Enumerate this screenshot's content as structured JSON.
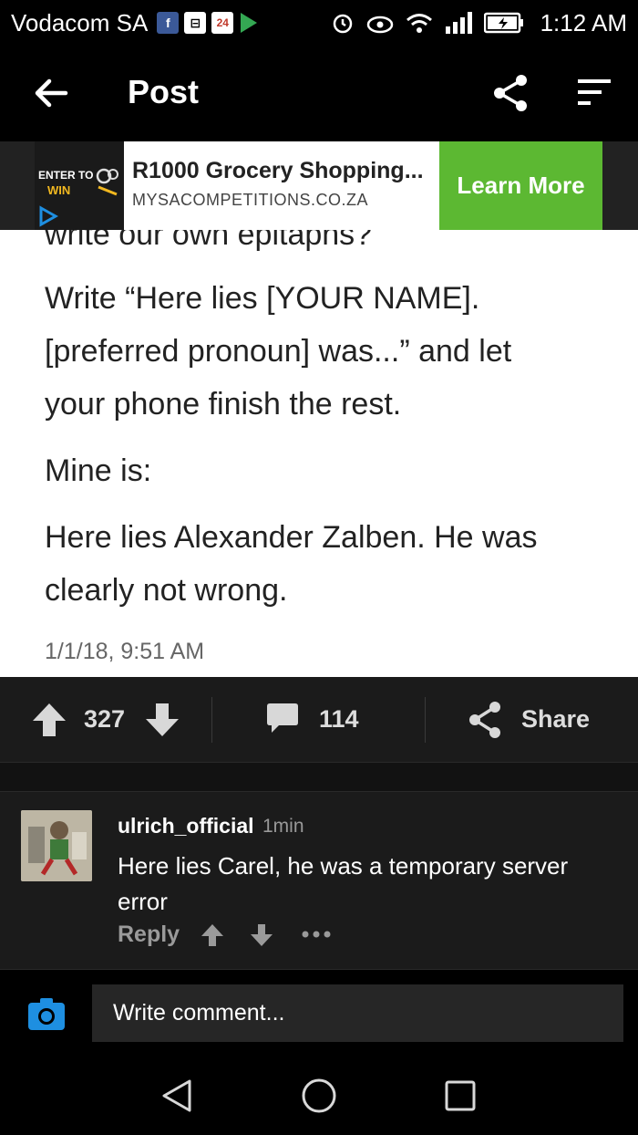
{
  "status_bar": {
    "carrier": "Vodacom SA",
    "news_badge": "24",
    "time": "1:12 AM"
  },
  "app_bar": {
    "title": "Post"
  },
  "ad": {
    "logo_line1": "ENTER TO",
    "logo_line2": "WIN",
    "title": "R1000 Grocery Shopping...",
    "domain": "MYSACOMPETITIONS.CO.ZA",
    "cta": "Learn More",
    "cta_color": "#5cb832"
  },
  "post": {
    "cut_line": "write our own epitaphs?",
    "lines": [
      "Write “Here lies [YOUR NAME].",
      "[preferred pronoun] was...” and let",
      "your phone finish the rest.",
      "Mine is:",
      "Here lies Alexander Zalben. He was",
      "clearly not wrong."
    ],
    "date": "1/1/18, 9:51 AM"
  },
  "actions": {
    "votes": "327",
    "comments": "114",
    "share_label": "Share"
  },
  "comment": {
    "username": "ulrich_official",
    "time": "1min",
    "text": "Here lies Carel, he was a temporary server error",
    "reply_label": "Reply"
  },
  "composer": {
    "placeholder": "Write comment..."
  },
  "colors": {
    "accent_blue": "#1e8fe1",
    "status_icon_fb": "#3b5998",
    "play_icon": "#34a853"
  }
}
